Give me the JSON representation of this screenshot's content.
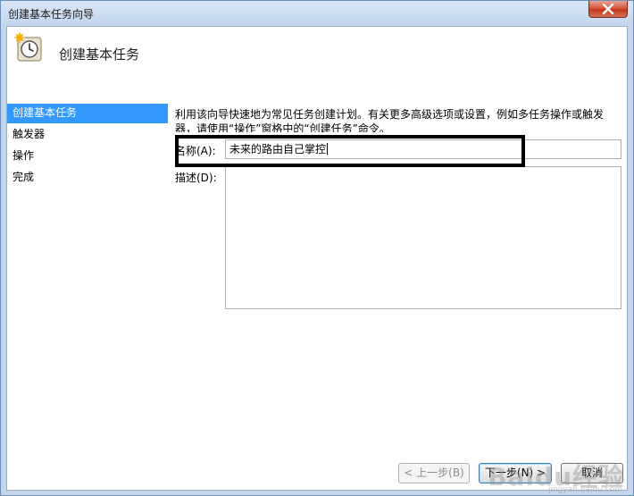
{
  "window": {
    "title": "创建基本任务向导",
    "close_icon": "close-x-icon"
  },
  "header": {
    "title": "创建基本任务",
    "icon": "clock-task-icon"
  },
  "steps": [
    {
      "label": "创建基本任务",
      "active": true
    },
    {
      "label": "触发器",
      "active": false
    },
    {
      "label": "操作",
      "active": false
    },
    {
      "label": "完成",
      "active": false
    }
  ],
  "main": {
    "description": "利用该向导快速地为常见任务创建计划。有关更多高级选项或设置，例如多任务操作或触发器，请使用“操作”窗格中的“创建任务”命令。",
    "name_label": "名称(A):",
    "name_value": "未来的路由自己掌控",
    "desc_label": "描述(D):",
    "desc_value": ""
  },
  "buttons": {
    "back": "< 上一步(B)",
    "next": "下一步(N) >",
    "cancel": "取消"
  },
  "watermark": {
    "text": "Baidu经验",
    "sub": "jingyan.baidu.com"
  },
  "colors": {
    "accent": "#3399ff",
    "frame": "#c4d6ec",
    "close": "#c4381c"
  }
}
